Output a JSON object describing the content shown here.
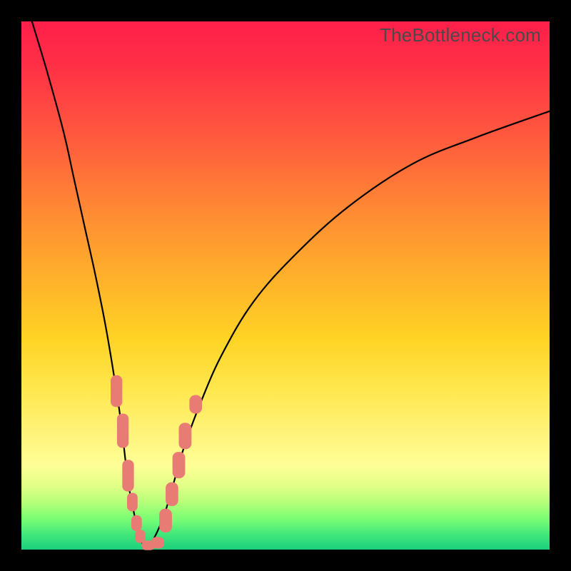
{
  "watermark": "TheBottleneck.com",
  "chart_data": {
    "type": "line",
    "title": "",
    "xlabel": "",
    "ylabel": "",
    "xlim": [
      0,
      100
    ],
    "ylim": [
      0,
      100
    ],
    "grid": false,
    "legend": false,
    "annotations": [],
    "series": [
      {
        "name": "curve-left",
        "x": [
          2,
          5,
          8,
          10,
          12,
          14,
          16,
          18,
          19,
          19.8,
          20.5,
          21.3,
          22.0,
          22.7,
          24
        ],
        "values": [
          100,
          90,
          79,
          70,
          61,
          52,
          42,
          30,
          23,
          16,
          11,
          7,
          3.5,
          1.5,
          0
        ]
      },
      {
        "name": "curve-right",
        "x": [
          24,
          26,
          27.5,
          29.5,
          31,
          34,
          38,
          44,
          52,
          62,
          74,
          86,
          100
        ],
        "values": [
          0,
          4,
          8,
          15,
          20,
          28,
          37,
          47,
          56,
          65,
          73,
          78,
          83
        ]
      },
      {
        "name": "markers",
        "style": "rounded-rect",
        "color": "#e97b75",
        "points": [
          {
            "x": 18.0,
            "y": 30.0,
            "w": 2.2,
            "h": 6.0
          },
          {
            "x": 19.2,
            "y": 22.5,
            "w": 2.2,
            "h": 6.5
          },
          {
            "x": 20.2,
            "y": 14.0,
            "w": 2.2,
            "h": 6.0
          },
          {
            "x": 21.0,
            "y": 9.0,
            "w": 2.0,
            "h": 3.5
          },
          {
            "x": 21.8,
            "y": 5.0,
            "w": 2.0,
            "h": 3.0
          },
          {
            "x": 22.5,
            "y": 2.5,
            "w": 2.0,
            "h": 2.5
          },
          {
            "x": 24.0,
            "y": 0.8,
            "w": 2.5,
            "h": 1.8
          },
          {
            "x": 25.8,
            "y": 1.3,
            "w": 2.5,
            "h": 2.2
          },
          {
            "x": 27.3,
            "y": 5.5,
            "w": 2.4,
            "h": 4.5
          },
          {
            "x": 28.5,
            "y": 10.5,
            "w": 2.4,
            "h": 4.5
          },
          {
            "x": 29.8,
            "y": 16.0,
            "w": 2.4,
            "h": 5.0
          },
          {
            "x": 31.0,
            "y": 21.5,
            "w": 2.4,
            "h": 5.0
          },
          {
            "x": 33.0,
            "y": 27.5,
            "w": 2.4,
            "h": 3.5
          }
        ]
      }
    ]
  }
}
